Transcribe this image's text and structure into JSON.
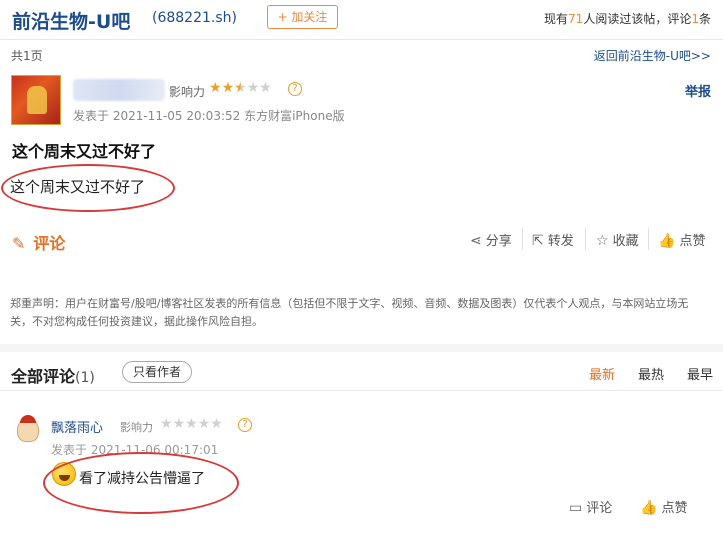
{
  "header": {
    "bar_title": "前沿生物-U吧",
    "stock_code": "(688221.sh)",
    "follow_label": "+ 加关注",
    "readers_prefix": "现有",
    "readers_count": "71",
    "readers_mid": "人阅读过该帖，评论",
    "comments_count": "1",
    "readers_suffix": "条"
  },
  "sub_bar": {
    "page_count": "共1页",
    "back_link": "返回前沿生物-U吧>>"
  },
  "post": {
    "influence_label": "影响力",
    "stars_rating": 2.5,
    "help_glyph": "?",
    "time": "发表于 2021-11-05 20:03:52 东方财富iPhone版",
    "report_label": "举报",
    "title": "这个周末又过不好了",
    "body": "这个周末又过不好了",
    "comment_label": "评论",
    "actions": {
      "share": "分享",
      "forward": "转发",
      "favorite": "收藏",
      "like": "点赞"
    },
    "disclaimer": "郑重声明：用户在财富号/股吧/博客社区发表的所有信息（包括但不限于文字、视频、音频、数据及图表）仅代表个人观点，与本网站立场无关，不对您构成任何投资建议，据此操作风险自担。"
  },
  "comments_section": {
    "title": "全部评论",
    "count": "(1)",
    "author_only": "只看作者",
    "sort_options": [
      "最新",
      "最热",
      "最早"
    ],
    "active_sort": "最新"
  },
  "comment": {
    "username": "飘落雨心",
    "influence_label": "影响力",
    "stars_rating": 0,
    "help_glyph": "?",
    "time": "发表于 2021-11-06 00:17:01",
    "text": "看了减持公告懵逼了",
    "reply_label": "评论",
    "like_label": "点赞"
  },
  "colors": {
    "brand_blue": "#1d4c8c",
    "accent_orange": "#e0722a",
    "annotation_red": "#d63a3a"
  }
}
